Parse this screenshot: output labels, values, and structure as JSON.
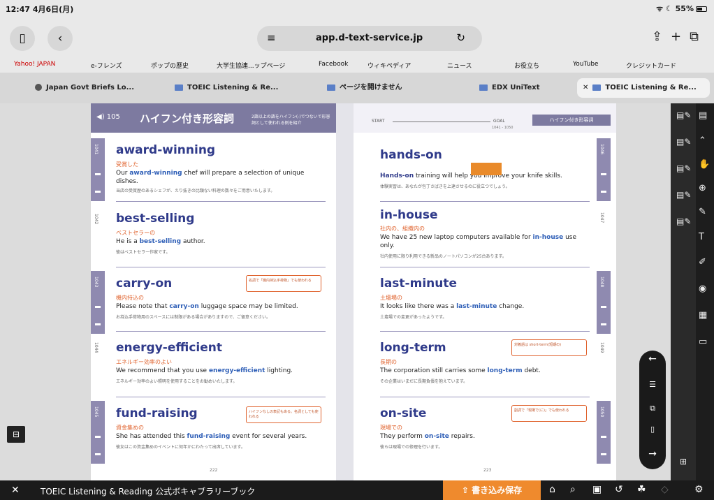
{
  "status": {
    "time": "12:47",
    "date": "4月6日(月)",
    "battery": "55%"
  },
  "toolbar": {
    "url": "app.d-text-service.jp"
  },
  "bookmarks": [
    "Yahoo! JAPAN",
    "e-フレンズ",
    "ポップの歴史",
    "大学生協連...ップページ",
    "Facebook",
    "ウィキペディア",
    "ニュース",
    "お役立ち",
    "YouTube",
    "クレジットカード"
  ],
  "tabs": [
    "Japan Govt Briefs Lo...",
    "TOEIC Listening & Re...",
    "ページを開けません",
    "EDX UniText",
    "TOEIC Listening & Re..."
  ],
  "book": {
    "left_header": {
      "number": "105",
      "title": "ハイフン付き形容詞",
      "subtitle": "2語以上の語をハイフン(-)でつないで形容詞として使われる例を紹介"
    },
    "right_header": {
      "start": "START",
      "goal": "GOAL",
      "range": "1041 - 1050",
      "tag": "ハイフン付き形容詞"
    },
    "left_entries": [
      {
        "index": "1041",
        "word": "award-winning",
        "meaning": "受賞した",
        "s1": "Our ",
        "hl": "award-winning",
        "s2": " chef will prepare a selection of unique dishes.",
        "trans": "当店の受賞歴のあるシェフが、えり抜きの比類ない料理の数々をご用意いたします。",
        "note": ""
      },
      {
        "index": "1042",
        "word": "best-selling",
        "meaning": "ベストセラーの",
        "s1": "He is a ",
        "hl": "best-selling",
        "s2": " author.",
        "trans": "彼はベストセラー作家です。",
        "note": ""
      },
      {
        "index": "1043",
        "word": "carry-on",
        "meaning": "機内持込の",
        "s1": "Please note that ",
        "hl": "carry-on",
        "s2": " luggage space may be limited.",
        "trans": "お持込手荷物用のスペースには制限がある場合がありますので、ご留意ください。",
        "note": "名詞で「機内持込手荷物」でも使われる"
      },
      {
        "index": "1044",
        "word": "energy-efficient",
        "meaning": "エネルギー効率のよい",
        "s1": "We recommend that you use ",
        "hl": "energy-efficient",
        "s2": " lighting.",
        "trans": "エネルギー効率のよい照明を使用することをお勧めいたします。",
        "note": ""
      },
      {
        "index": "1045",
        "word": "fund-raising",
        "meaning": "資金集めの",
        "s1": "She has attended this ",
        "hl": "fund-raising",
        "s2": " event for several years.",
        "trans": "彼女はこの資金集めのイベントに何年かにわたって出席しています。",
        "note": "ハイフンなしの表記もある。名詞としても使われる"
      }
    ],
    "right_entries": [
      {
        "index": "1046",
        "word": "hands-on",
        "meaning": "",
        "s1": "",
        "hl": "Hands-on",
        "s2": " training will help you improve your knife skills.",
        "trans": "体験実習は、あなたが包丁さばきを上達させるのに役立つでしょう。",
        "note": ""
      },
      {
        "index": "1047",
        "word": "in-house",
        "meaning": "社内の、組織内の",
        "s1": "We have 25 new laptop computers available for ",
        "hl": "in-house",
        "s2": " use only.",
        "trans": "社内使用に限り利用できる新品のノートパソコンが25台あります。",
        "note": ""
      },
      {
        "index": "1048",
        "word": "last-minute",
        "meaning": "土壇場の",
        "s1": "It looks like there was a ",
        "hl": "last-minute",
        "s2": " change.",
        "trans": "土壇場での変更があったようです。",
        "note": ""
      },
      {
        "index": "1049",
        "word": "long-term",
        "meaning": "長期の",
        "s1": "The corporation still carries some ",
        "hl": "long-term",
        "s2": " debt.",
        "trans": "その企業はいまだに長期負債を抱えています。",
        "note": "対義語は short-term(短期の)"
      },
      {
        "index": "1050",
        "word": "on-site",
        "meaning": "現場での",
        "s1": "They perform ",
        "hl": "on-site",
        "s2": " repairs.",
        "trans": "彼らは現場での修理を行います。",
        "note": "副詞で「現場で(に)」でも使われる"
      }
    ],
    "page_left": "222",
    "page_right": "223"
  },
  "bottom": {
    "title": "TOEIC Listening & Reading 公式ボキャブラリーブック",
    "save": "書き込み保存"
  }
}
